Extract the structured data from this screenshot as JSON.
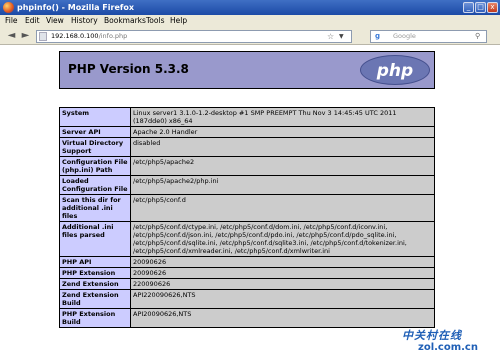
{
  "window": {
    "title": "phpinfo() - Mozilla Firefox",
    "buttons": {
      "minimize": "_",
      "maximize": "□",
      "close": "x"
    }
  },
  "menu": [
    "File",
    "Edit",
    "View",
    "History",
    "Bookmarks",
    "Tools",
    "Help"
  ],
  "toolbar": {
    "back_glyph": "◄",
    "forward_glyph": "►",
    "url_host": "192.168.0.100",
    "url_path": "/info.php",
    "star_glyph": "☆",
    "dropdown_glyph": "▼",
    "search_engine_glyph": "g",
    "search_placeholder": "Google",
    "search_glyph": "⚲"
  },
  "php_header": {
    "version": "PHP Version 5.3.8",
    "logo_text": "php"
  },
  "info_rows": [
    {
      "label": "System",
      "value": "Linux server1 3.1.0-1.2-desktop #1 SMP PREEMPT Thu Nov 3 14:45:45 UTC 2011 (187dde0) x86_64"
    },
    {
      "label": "Server API",
      "value": "Apache 2.0 Handler"
    },
    {
      "label": "Virtual Directory Support",
      "value": "disabled"
    },
    {
      "label": "Configuration File (php.ini) Path",
      "value": "/etc/php5/apache2"
    },
    {
      "label": "Loaded Configuration File",
      "value": "/etc/php5/apache2/php.ini"
    },
    {
      "label": "Scan this dir for additional .ini files",
      "value": "/etc/php5/conf.d"
    },
    {
      "label": "Additional .ini files parsed",
      "value": "/etc/php5/conf.d/ctype.ini, /etc/php5/conf.d/dom.ini, /etc/php5/conf.d/iconv.ini, /etc/php5/conf.d/json.ini, /etc/php5/conf.d/pdo.ini, /etc/php5/conf.d/pdo_sqlite.ini, /etc/php5/conf.d/sqlite.ini, /etc/php5/conf.d/sqlite3.ini, /etc/php5/conf.d/tokenizer.ini, /etc/php5/conf.d/xmlreader.ini, /etc/php5/conf.d/xmlwriter.ini"
    },
    {
      "label": "PHP API",
      "value": "20090626"
    },
    {
      "label": "PHP Extension",
      "value": "20090626"
    },
    {
      "label": "Zend Extension",
      "value": "220090626"
    },
    {
      "label": "Zend Extension Build",
      "value": "API220090626,NTS"
    },
    {
      "label": "PHP Extension Build",
      "value": "API20090626,NTS"
    }
  ],
  "watermark": {
    "logo": "中关村在线",
    "url": "zol.com.cn"
  },
  "colors": {
    "php_header": "#9999cc",
    "label_cell": "#ccccff",
    "value_cell": "#cccccc",
    "titlebar": "#1c4aa6"
  }
}
